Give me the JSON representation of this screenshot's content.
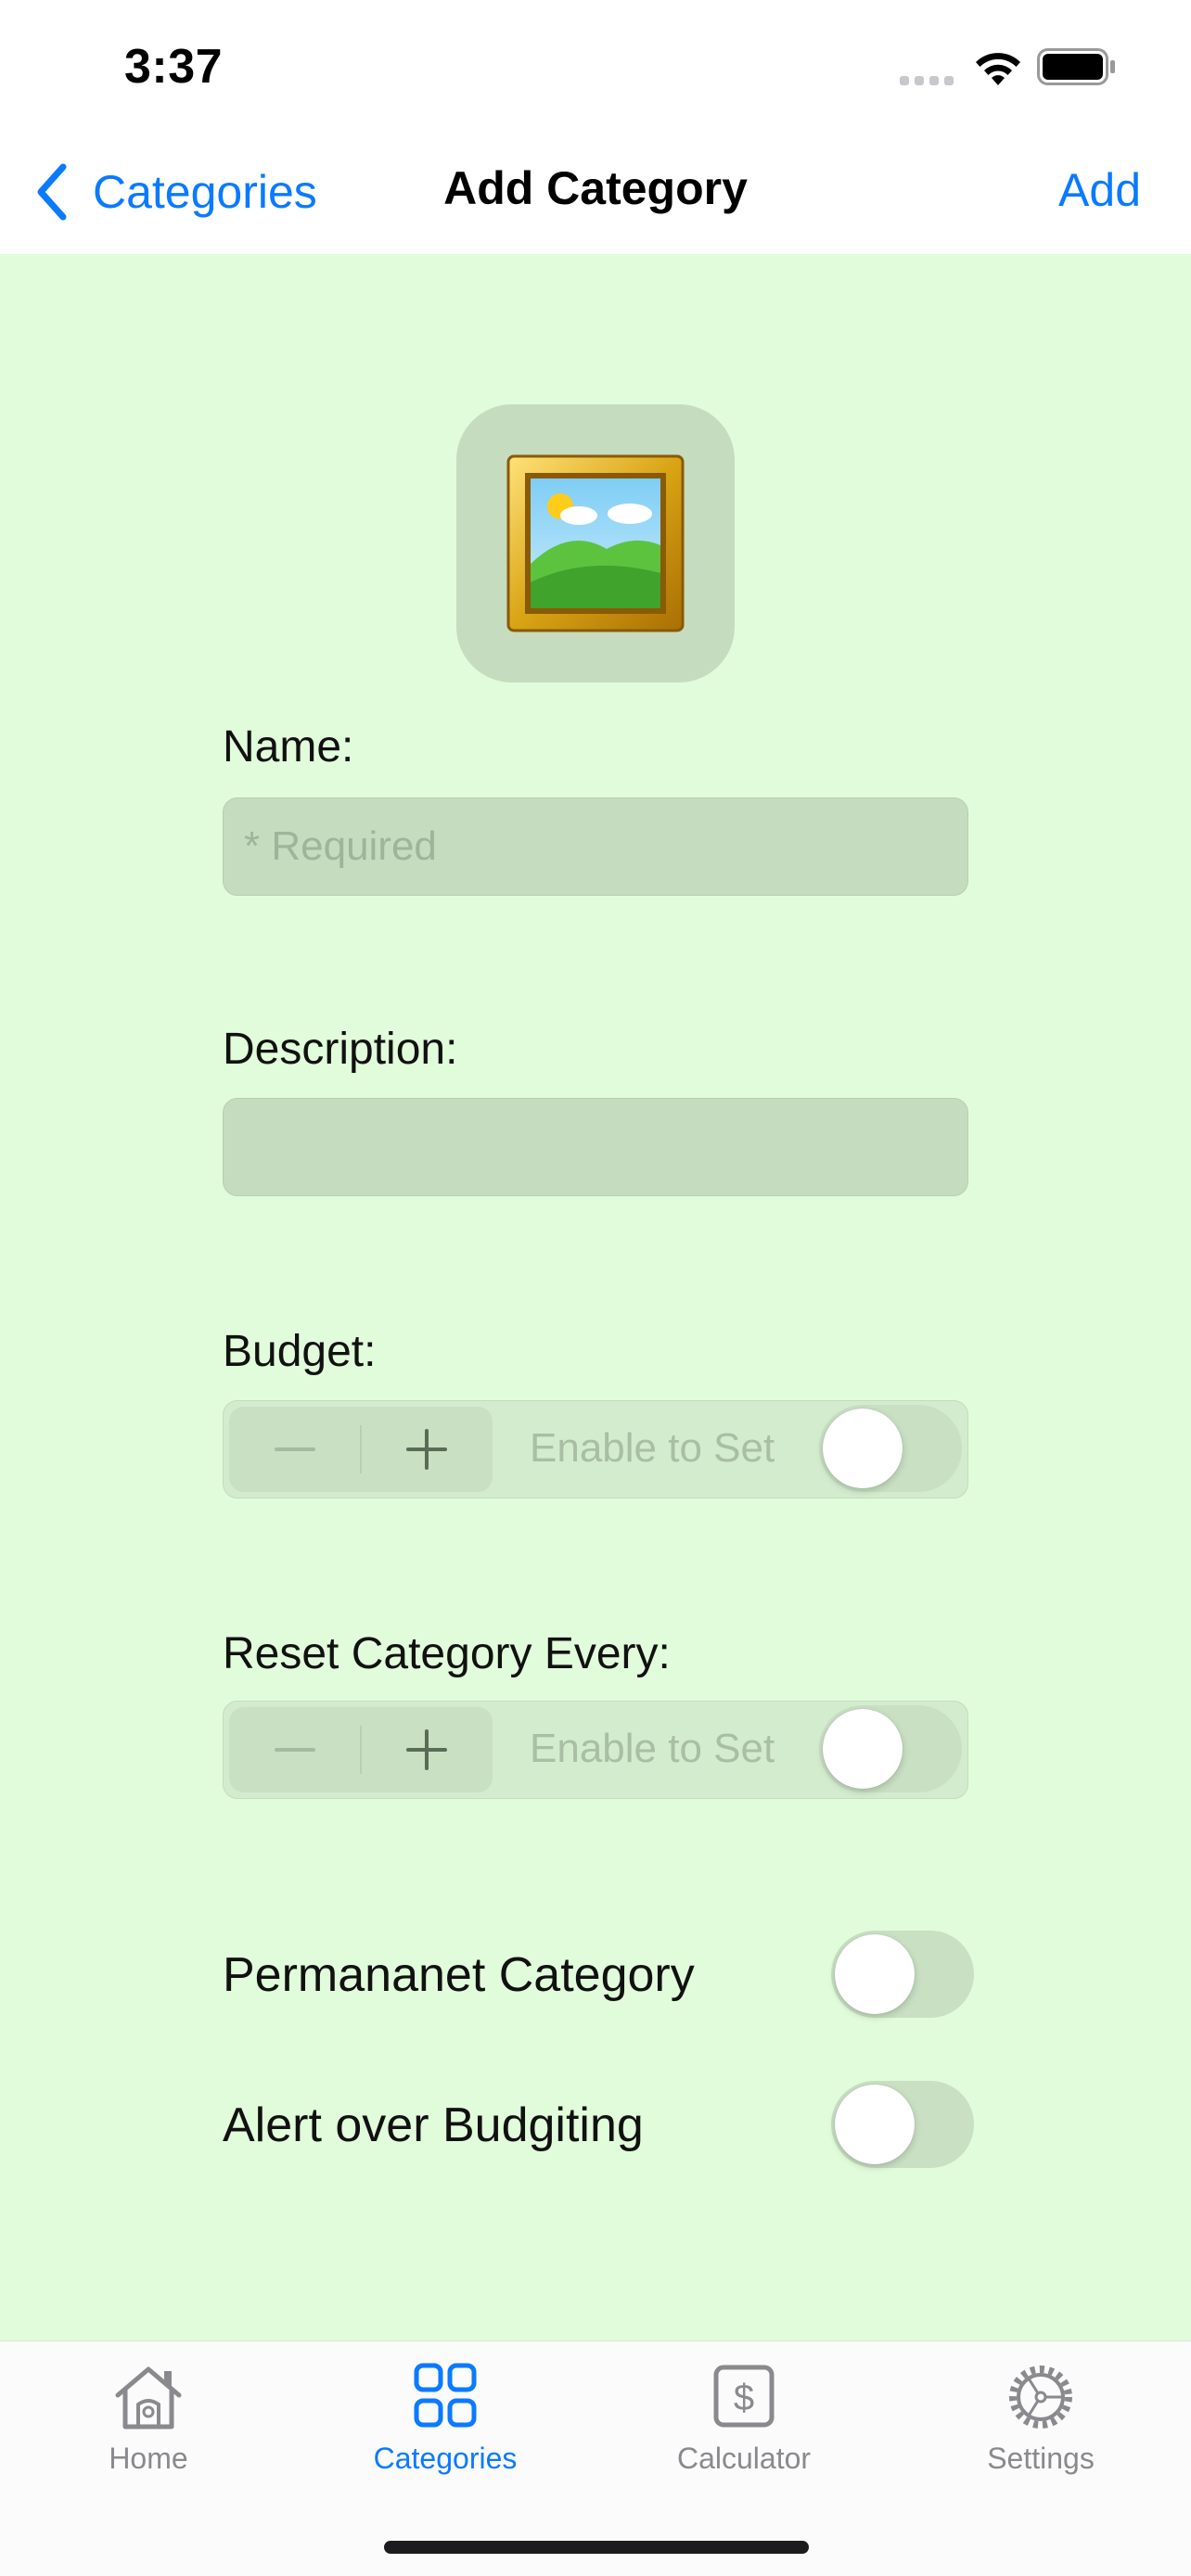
{
  "status_bar": {
    "time": "3:37"
  },
  "nav": {
    "back_label": "Categories",
    "title": "Add Category",
    "add_label": "Add"
  },
  "form": {
    "image_icon": "framed-picture-icon",
    "name_label": "Name:",
    "name_placeholder": "* Required",
    "name_value": "",
    "description_label": "Description:",
    "description_value": "",
    "budget_label": "Budget:",
    "budget_status": "Enable to Set",
    "budget_enabled": false,
    "reset_label": "Reset Category Every:",
    "reset_status": "Enable to Set",
    "reset_enabled": false,
    "permanent_label": "Permananet Category",
    "permanent_enabled": false,
    "alert_label": "Alert over Budgiting",
    "alert_enabled": false
  },
  "tabs": [
    {
      "label": "Home",
      "icon": "house-icon",
      "active": false
    },
    {
      "label": "Categories",
      "icon": "grid-icon",
      "active": true
    },
    {
      "label": "Calculator",
      "icon": "dollar-square-icon",
      "active": false
    },
    {
      "label": "Settings",
      "icon": "gear-icon",
      "active": false
    }
  ],
  "colors": {
    "accent": "#0a7aff",
    "background": "#e1fcda",
    "field": "#c6dcbf"
  }
}
